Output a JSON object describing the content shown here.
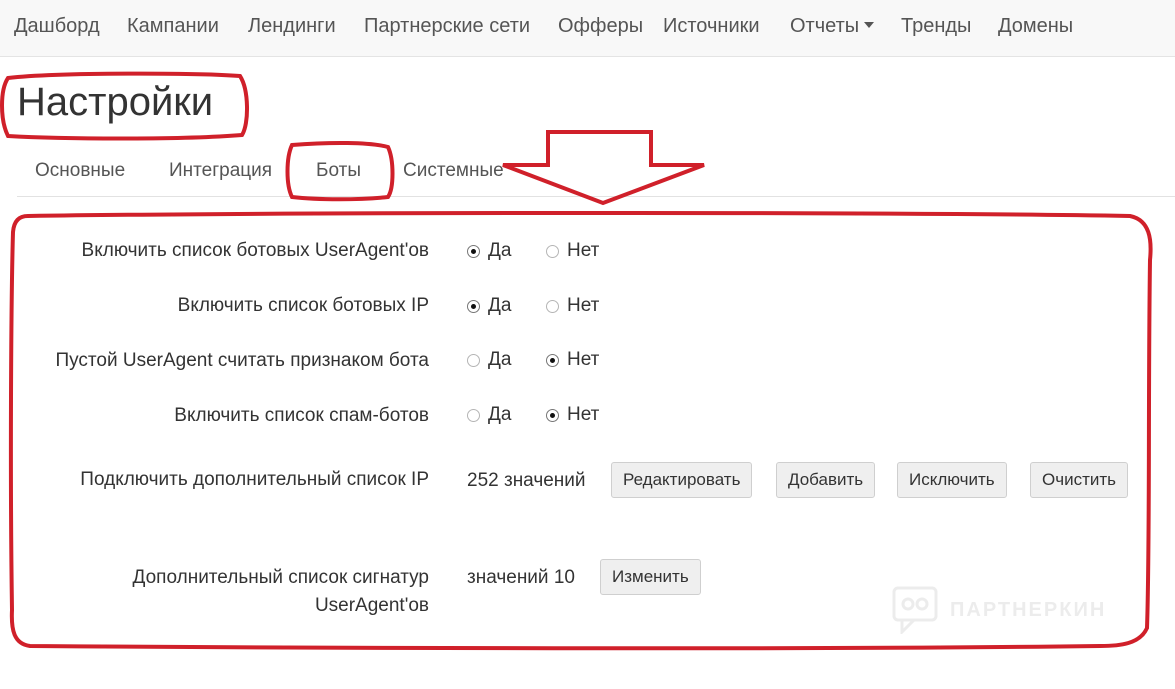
{
  "nav": {
    "items": [
      {
        "label": "Дашборд"
      },
      {
        "label": "Кампании"
      },
      {
        "label": "Лендинги"
      },
      {
        "label": "Партнерские сети"
      },
      {
        "label": "Офферы"
      },
      {
        "label": "Источники"
      },
      {
        "label": "Отчеты"
      },
      {
        "label": "Тренды"
      },
      {
        "label": "Домены"
      }
    ]
  },
  "page": {
    "title": "Настройки"
  },
  "tabs": [
    {
      "label": "Основные"
    },
    {
      "label": "Интеграция"
    },
    {
      "label": "Боты",
      "active": true
    },
    {
      "label": "Системные"
    }
  ],
  "settings": {
    "bot_useragents": {
      "label": "Включить список ботовых UserAgent'ов",
      "yes": "Да",
      "no": "Нет",
      "value": "yes"
    },
    "bot_ip": {
      "label": "Включить список ботовых IP",
      "yes": "Да",
      "no": "Нет",
      "value": "yes"
    },
    "empty_useragent": {
      "label": "Пустой UserAgent считать признаком бота",
      "yes": "Да",
      "no": "Нет",
      "value": "no"
    },
    "spam_bots": {
      "label": "Включить список спам-ботов",
      "yes": "Да",
      "no": "Нет",
      "value": "no"
    },
    "extra_ip": {
      "label": "Подключить дополнительный список IP",
      "count_text": "252 значений",
      "edit_label": "Редактировать",
      "add_label": "Добавить",
      "exclude_label": "Исключить",
      "clear_label": "Очистить"
    },
    "signatures": {
      "label_line1": "Дополнительный список сигнатур",
      "label_line2": "UserAgent'ов",
      "count_text": "значений 10",
      "change_label": "Изменить"
    }
  },
  "watermark": {
    "text": "ПАРТНЕРКИН"
  },
  "colors": {
    "annotation": "#d0202a",
    "nav_bg": "#f8f8f8",
    "button_bg": "#efefef"
  }
}
